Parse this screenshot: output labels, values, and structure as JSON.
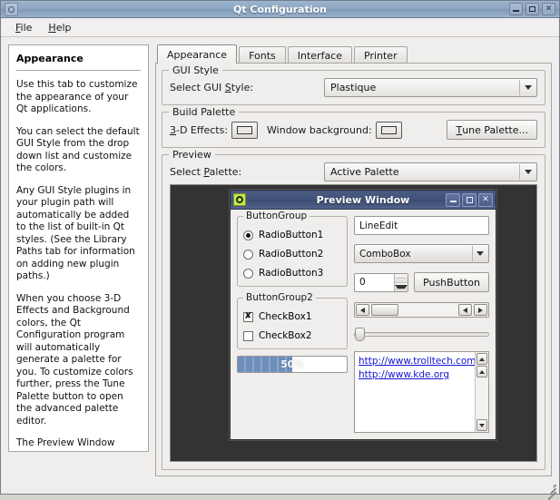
{
  "window": {
    "title": "Qt Configuration",
    "icon": "app-ring-icon",
    "buttons": {
      "minimize": "–",
      "maximize": "□",
      "close": "✕"
    }
  },
  "menubar": {
    "items": [
      {
        "label": "File",
        "accel": "F"
      },
      {
        "label": "Help",
        "accel": "H"
      }
    ]
  },
  "help_panel": {
    "title": "Appearance",
    "paragraphs": [
      "Use this tab to customize the appearance of your Qt applications.",
      "You can select the default GUI Style from the drop down list and customize the colors.",
      "Any GUI Style plugins in your plugin path will automatically be added to the list of built-in Qt styles. (See the Library Paths tab for information on adding new plugin paths.)",
      "When you choose 3-D Effects and Background colors, the Qt Configuration program will automatically generate a palette for you. To customize colors further, press the Tune Palette button to open the advanced palette editor.",
      "The Preview Window shows what the selected Style and colors look like."
    ]
  },
  "tabs": [
    {
      "label": "Appearance",
      "active": true
    },
    {
      "label": "Fonts",
      "active": false
    },
    {
      "label": "Interface",
      "active": false
    },
    {
      "label": "Printer",
      "active": false
    }
  ],
  "gui_style_group": {
    "title": "GUI Style",
    "select_label": "Select GUI Style:",
    "select_label_accel": "S",
    "selected_style": "Plastique"
  },
  "build_palette_group": {
    "title": "Build Palette",
    "effects_label": "3-D Effects:",
    "effects_label_accel": "3",
    "window_bg_label": "Window background:",
    "tune_button": "Tune Palette...",
    "tune_button_accel": "T"
  },
  "preview_group": {
    "title": "Preview",
    "select_label": "Select Palette:",
    "select_label_accel": "P",
    "selected_palette": "Active Palette"
  },
  "preview_window": {
    "title": "Preview Window",
    "icon": "qt-logo-icon",
    "buttons": {
      "minimize": "–",
      "maximize": "□",
      "close": "✕"
    },
    "button_group": {
      "title": "ButtonGroup",
      "radios": [
        {
          "label": "RadioButton1",
          "checked": true
        },
        {
          "label": "RadioButton2",
          "checked": false
        },
        {
          "label": "RadioButton3",
          "checked": false
        }
      ]
    },
    "button_group2": {
      "title": "ButtonGroup2",
      "checkboxes": [
        {
          "label": "CheckBox1",
          "checked": true,
          "mark": "✘"
        },
        {
          "label": "CheckBox2",
          "checked": false,
          "mark": ""
        }
      ]
    },
    "progress": {
      "value": 50,
      "text": "50%"
    },
    "line_edit": {
      "value": "LineEdit"
    },
    "combo_box": {
      "value": "ComboBox"
    },
    "spin_box": {
      "value": "0"
    },
    "push_button": {
      "label": "PushButton"
    },
    "links": [
      "http://www.trolltech.com",
      "http://www.kde.org"
    ]
  },
  "colors": {
    "title_bar": "#8fa8c4",
    "preview_title_bar": "#41537a",
    "preview_backdrop": "#333333",
    "link": "#1414d2",
    "progress_fill": "#6f8fbb",
    "qt_icon": "#c8e84b"
  }
}
